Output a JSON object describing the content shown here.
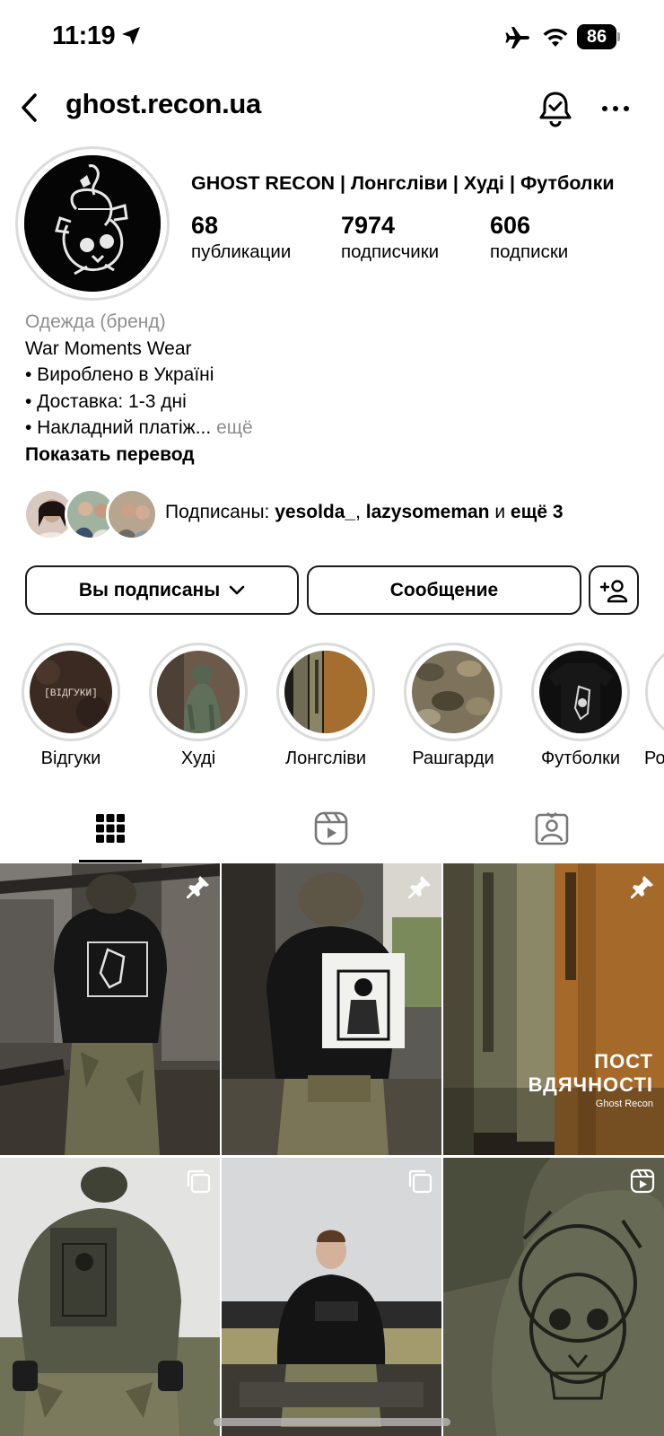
{
  "status_bar": {
    "time": "11:19",
    "battery": "86"
  },
  "header": {
    "username": "ghost.recon.ua"
  },
  "profile": {
    "display_name": "GHOST RECON | Лонгсліви | Худі | Футболки",
    "stats": [
      {
        "value": "68",
        "label": "публикации"
      },
      {
        "value": "7974",
        "label": "подписчики"
      },
      {
        "value": "606",
        "label": "подписки"
      }
    ],
    "category": "Одежда (бренд)",
    "bio_lines": [
      "War Moments Wear",
      "• Вироблено в Україні",
      "• Доставка: 1-3 дні",
      "• Накладний платіж..."
    ],
    "more_label": "ещё",
    "translate_label": "Показать перевод"
  },
  "followed_by": {
    "prefix": "Подписаны: ",
    "user1": "yesolda_",
    "separator": ", ",
    "user2": "lazysomeman",
    "conjunction": " и ",
    "rest": "ещё 3"
  },
  "actions": {
    "following_label": "Вы подписаны",
    "message_label": "Сообщение"
  },
  "highlights": [
    {
      "label": "Відгуки",
      "cover_text": "[ВІДГУКИ]"
    },
    {
      "label": "Худі"
    },
    {
      "label": "Лонгсліви"
    },
    {
      "label": "Рашгарди"
    },
    {
      "label": "Футболки"
    },
    {
      "label": "Ро"
    }
  ],
  "tabs": [
    {
      "name": "posts",
      "icon": "grid-icon"
    },
    {
      "name": "reels",
      "icon": "reels-icon"
    },
    {
      "name": "tagged",
      "icon": "tagged-person-icon"
    }
  ],
  "posts": [
    {
      "badge": "pin-icon"
    },
    {
      "badge": "pin-icon"
    },
    {
      "badge": "pin-icon",
      "overlay_title_1": "ПОСТ",
      "overlay_title_2": "ВДЯЧНОСТІ",
      "overlay_sub": "Ghost Recon"
    },
    {
      "badge": "carousel-icon"
    },
    {
      "badge": "carousel-icon"
    },
    {
      "badge": "reel-icon"
    }
  ],
  "colors": {
    "text": "#000000",
    "muted": "#8e8e8e",
    "border": "#1a1a1a",
    "ring": "#dbdbdb"
  }
}
